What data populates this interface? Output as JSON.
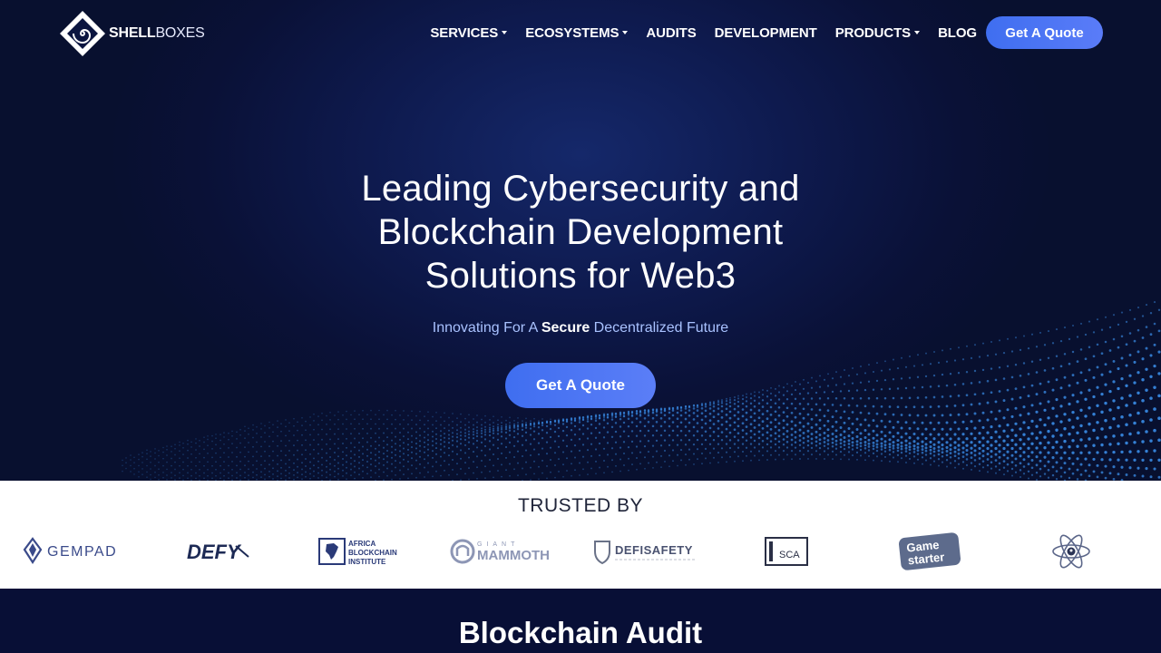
{
  "brand": {
    "name_bold": "SHELL",
    "name_light": "BOXES",
    "logo_icon": "spiral-diamond-icon"
  },
  "nav": {
    "items": [
      {
        "label": "SERVICES",
        "dropdown": true
      },
      {
        "label": "ECOSYSTEMS",
        "dropdown": true
      },
      {
        "label": "AUDITS",
        "dropdown": false
      },
      {
        "label": "DEVELOPMENT",
        "dropdown": false
      },
      {
        "label": "PRODUCTS",
        "dropdown": true
      },
      {
        "label": "BLOG",
        "dropdown": false
      }
    ],
    "cta_label": "Get A Quote"
  },
  "hero": {
    "title_lines": [
      "Leading Cybersecurity and",
      "Blockchain Development",
      "Solutions for Web3"
    ],
    "subtitle_pre": "Innovating For A ",
    "subtitle_bold": "Secure",
    "subtitle_post": " Decentralized Future",
    "cta_label": "Get A Quote"
  },
  "trusted": {
    "title": "TRUSTED BY",
    "partners": [
      {
        "name": "GEMPAD",
        "icon": "gempad-logo"
      },
      {
        "name": "DEFY",
        "icon": "defy-logo"
      },
      {
        "name": "AFRICA BLOCKCHAIN INSTITUTE",
        "lines": [
          "AFRICA",
          "BLOCKCHAIN",
          "INSTITUTE"
        ],
        "icon": "africa-map-icon"
      },
      {
        "name": "GIANT MAMMOTH",
        "top": "GIANT",
        "bottom": "MAMMOTH",
        "icon": "mammoth-logo"
      },
      {
        "name": "DEFISAFETY",
        "icon": "shield-icon"
      },
      {
        "name": "SCA",
        "icon": "sca-logo"
      },
      {
        "name": "Game starter",
        "lines": [
          "Game",
          "starter"
        ],
        "icon": "gamestarter-logo"
      },
      {
        "name": "",
        "icon": "atom-icon"
      }
    ]
  },
  "section": {
    "title": "Blockchain Audit"
  },
  "colors": {
    "accent": "#4a73f4",
    "hero_bg": "#0a1137",
    "subtitle": "#a9c2ff",
    "dots": "#3a8de8"
  }
}
